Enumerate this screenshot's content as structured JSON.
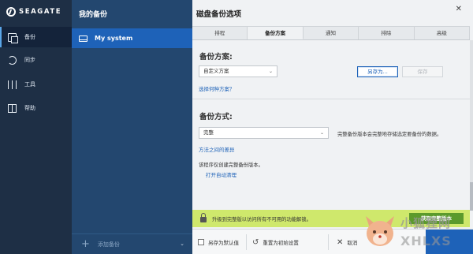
{
  "brand": {
    "logo_text": "SEAGATE"
  },
  "nav": {
    "items": [
      {
        "label": "备份",
        "icon": "backup-icon",
        "active": true
      },
      {
        "label": "同步",
        "icon": "sync-icon",
        "active": false
      },
      {
        "label": "工具",
        "icon": "tools-icon",
        "active": false
      },
      {
        "label": "帮助",
        "icon": "help-icon",
        "active": false
      }
    ]
  },
  "backups": {
    "title": "我的备份",
    "items": [
      {
        "label": "My system",
        "icon": "drive-icon"
      }
    ],
    "add_label": "添加备份"
  },
  "dialog": {
    "title": "磁盘备份选项",
    "tabs": [
      {
        "label": "排程",
        "active": false
      },
      {
        "label": "备份方案",
        "active": true
      },
      {
        "label": "通知",
        "active": false
      },
      {
        "label": "排除",
        "active": false
      },
      {
        "label": "高级",
        "active": false
      }
    ],
    "scheme": {
      "title": "备份方案:",
      "selected": "自定义方案",
      "save_as": "另存为...",
      "save": "保存",
      "link": "选择何种方案？"
    },
    "method": {
      "title": "备份方式:",
      "selected": "完整",
      "description": "完整备份版本会完整地存储选定要备份的数据。",
      "link": "方法之间的差异",
      "note": "该程序仅创建完整备份版本。",
      "cleanup_link": "打开自动清理"
    },
    "banner": {
      "text": "升级到完整版以访问所有不可用的功能解锁。",
      "button": "获取完整版本"
    },
    "bottom": {
      "save_default": "另存为默认值",
      "reset": "重置为初始设置",
      "cancel": "取消"
    }
  },
  "watermark": {
    "text": "小狐狸网",
    "url": "XHLXS"
  },
  "colors": {
    "nav_bg": "#1e2f45",
    "list_bg": "#23476f",
    "selected_item": "#1e62b8",
    "link": "#1f63b8",
    "banner": "#cfe86c",
    "banner_button": "#5b9a2c"
  }
}
